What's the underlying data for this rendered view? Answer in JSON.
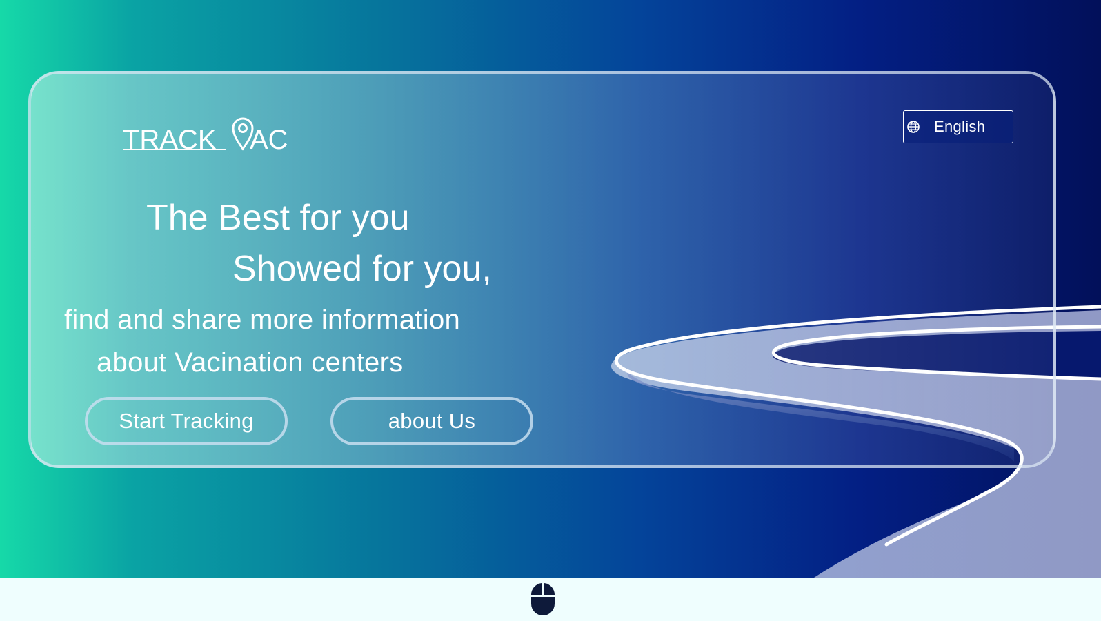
{
  "brand": {
    "logo_text_left": "TRACK",
    "logo_text_right": "AC",
    "logo_icon": "map-pin-icon"
  },
  "language": {
    "icon": "globe-icon",
    "selected": "English"
  },
  "hero": {
    "line1": "The Best for you",
    "line2": "Showed for you,",
    "line3": "find and share more information",
    "line4": "about Vacination centers"
  },
  "actions": {
    "start_label": "Start Tracking",
    "about_label": "about Us"
  },
  "footer": {
    "scroll_icon": "mouse-icon"
  },
  "colors": {
    "gradient_start": "#16d9a8",
    "gradient_end": "#02105a",
    "text": "#ffffff",
    "footer_background": "#effefe",
    "mouse_icon": "#0e1a3a"
  }
}
